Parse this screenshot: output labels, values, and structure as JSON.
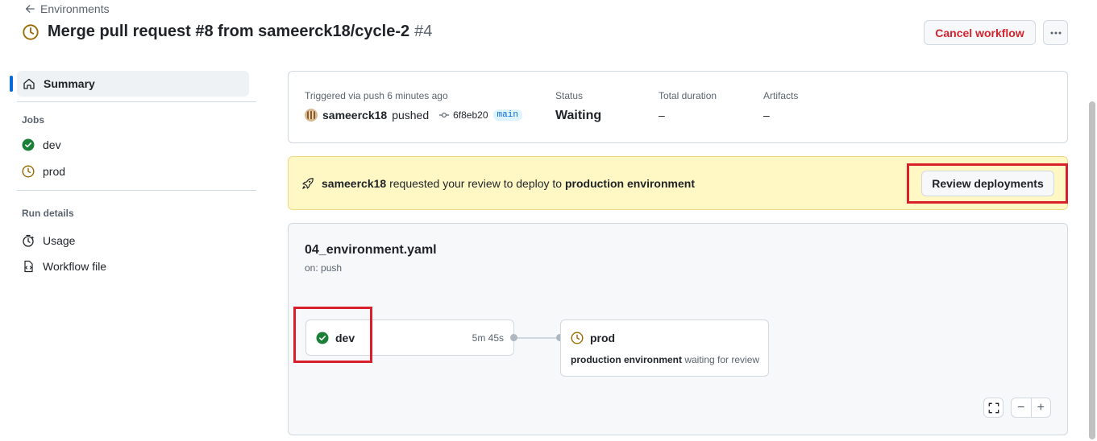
{
  "header": {
    "back_label": "Environments",
    "title": "Merge pull request #8 from sameerck18/cycle-2",
    "run_number": "#4",
    "cancel_label": "Cancel workflow",
    "more_label": "···"
  },
  "sidebar": {
    "summary_label": "Summary",
    "jobs_heading": "Jobs",
    "jobs": [
      {
        "label": "dev",
        "status": "success"
      },
      {
        "label": "prod",
        "status": "waiting"
      }
    ],
    "run_details_heading": "Run details",
    "details": [
      {
        "label": "Usage",
        "icon": "stopwatch-icon"
      },
      {
        "label": "Workflow file",
        "icon": "file-code-icon"
      }
    ]
  },
  "summary": {
    "trigger_label": "Triggered via push 6 minutes ago",
    "user": "sameerck18",
    "action": "pushed",
    "commit": "6f8eb20",
    "branch": "main",
    "status_label": "Status",
    "status_value": "Waiting",
    "duration_label": "Total duration",
    "duration_value": "–",
    "artifacts_label": "Artifacts",
    "artifacts_value": "–"
  },
  "banner": {
    "user": "sameerck18",
    "text_mid": "requested your review to deploy to",
    "environment": "production environment",
    "button_label": "Review deployments"
  },
  "graph": {
    "workflow_name": "04_environment.yaml",
    "trigger": "on: push",
    "dev": {
      "label": "dev",
      "time": "5m 45s"
    },
    "prod": {
      "label": "prod",
      "env": "production environment",
      "waiting": "waiting for review"
    },
    "zoom_out": "−",
    "zoom_in": "+"
  },
  "colors": {
    "accent": "#0969da",
    "success": "#1a7f37",
    "waiting": "#9a6700",
    "danger": "#d1242f",
    "highlight": "#d9202a",
    "banner_bg": "#fff8c5"
  }
}
